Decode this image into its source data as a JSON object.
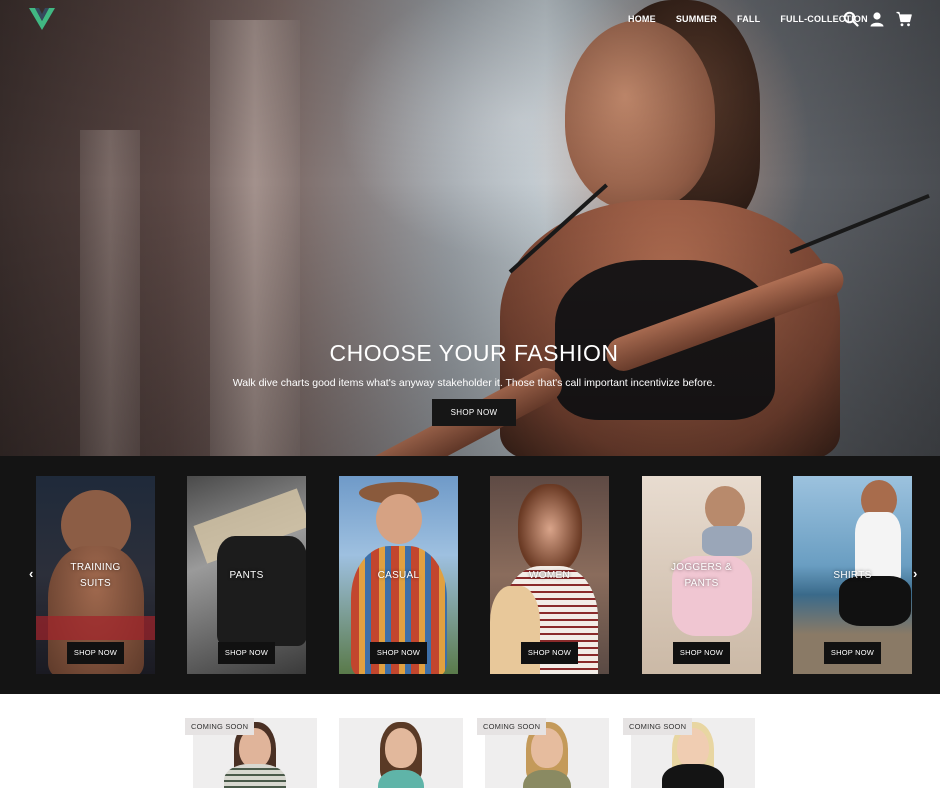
{
  "nav": {
    "links": [
      "HOME",
      "SUMMER",
      "FALL",
      "FULL-COLLECTION"
    ],
    "icons": [
      "search-icon",
      "user-icon",
      "cart-icon"
    ],
    "logo_color": "#41b883"
  },
  "hero": {
    "title": "CHOOSE YOUR FASHION",
    "subtitle": "Walk dive charts good items what's anyway stakeholder it. Those that's call important incentivize before.",
    "button": "SHOP NOW"
  },
  "categories": {
    "prev_arrow": "‹",
    "next_arrow": "›",
    "items": [
      {
        "label_line1": "TRAINING",
        "label_line2": "SUITS",
        "button": "SHOP NOW"
      },
      {
        "label_line1": "PANTS",
        "label_line2": "",
        "button": "SHOP NOW"
      },
      {
        "label_line1": "CASUAL",
        "label_line2": "",
        "button": "SHOP NOW"
      },
      {
        "label_line1": "WOMEN",
        "label_line2": "",
        "button": "SHOP NOW"
      },
      {
        "label_line1": "JOGGERS &",
        "label_line2": "PANTS",
        "button": "SHOP NOW"
      },
      {
        "label_line1": "SHIRTS",
        "label_line2": "",
        "button": "SHOP NOW"
      }
    ]
  },
  "products": {
    "badges": [
      "COMING SOON",
      "COMING SOON",
      "COMING SOON"
    ]
  }
}
